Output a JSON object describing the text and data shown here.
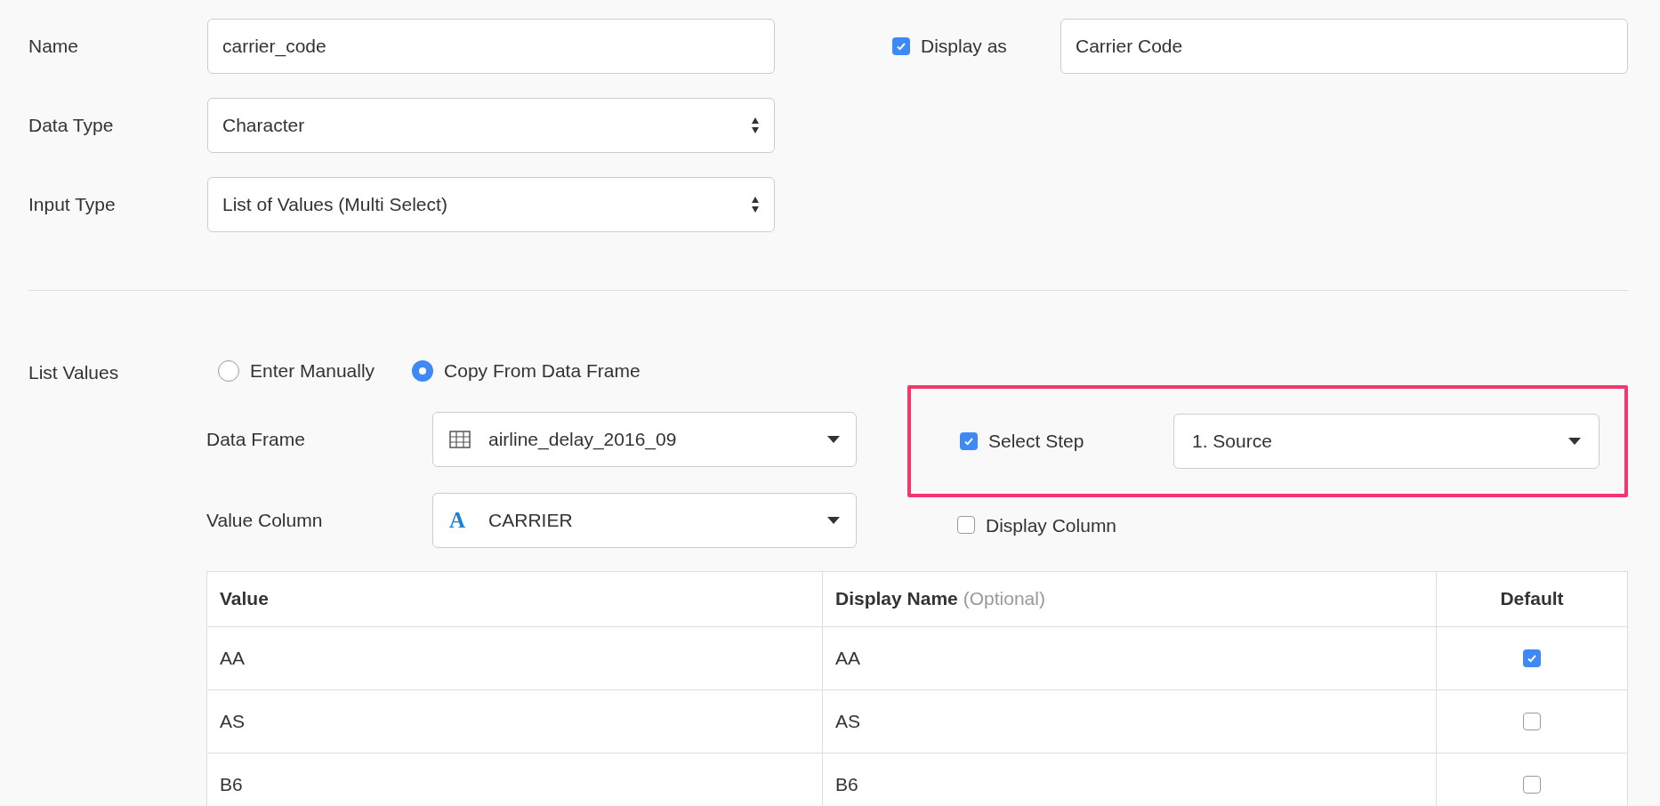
{
  "fields": [
    {
      "label": "Name",
      "kind": "text",
      "value": "carrier_code"
    },
    {
      "label": "Data Type",
      "kind": "select",
      "value": "Character"
    },
    {
      "label": "Input Type",
      "kind": "select",
      "value": "List of Values (Multi Select)"
    }
  ],
  "display_as": {
    "label": "Display as",
    "checked": true,
    "value": "Carrier Code"
  },
  "list_values": {
    "label": "List Values",
    "options": [
      {
        "label": "Enter Manually",
        "selected": false
      },
      {
        "label": "Copy From Data Frame",
        "selected": true
      }
    ],
    "data_frame": {
      "label": "Data Frame",
      "value": "airline_delay_2016_09"
    },
    "value_column": {
      "label": "Value Column",
      "type_glyph": "A",
      "value": "CARRIER"
    },
    "select_step": {
      "label": "Select Step",
      "checked": true,
      "highlighted": true,
      "value": "1. Source"
    },
    "display_column": {
      "label": "Display Column",
      "checked": false
    }
  },
  "table": {
    "columns": [
      {
        "label": "Value"
      },
      {
        "label": "Display Name",
        "note": "(Optional)"
      },
      {
        "label": "Default"
      }
    ],
    "rows": [
      {
        "value": "AA",
        "display_name": "AA",
        "default": true
      },
      {
        "value": "AS",
        "display_name": "AS",
        "default": false
      },
      {
        "value": "B6",
        "display_name": "B6",
        "default": false
      }
    ]
  }
}
